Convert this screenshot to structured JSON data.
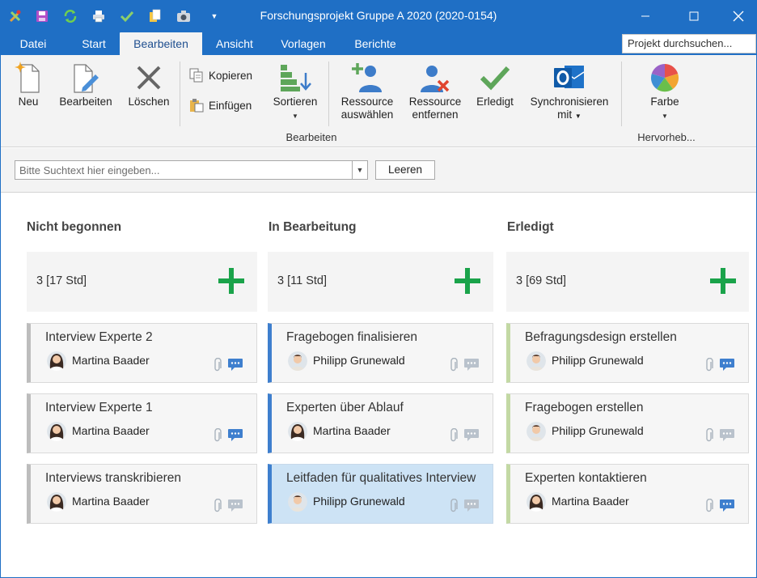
{
  "window": {
    "title": "Forschungsprojekt Gruppe A 2020 (2020-0154)",
    "quick_access": [
      "tools-icon",
      "save-icon",
      "refresh-icon",
      "print-icon",
      "check-icon",
      "copy-icon",
      "camera-icon",
      "customize-dropdown-icon"
    ],
    "controls": {
      "minimize": "—",
      "maximize": "☐",
      "close": "✕"
    }
  },
  "menu": {
    "tabs": [
      {
        "label": "Datei"
      },
      {
        "label": "Start"
      },
      {
        "label": "Bearbeiten"
      },
      {
        "label": "Ansicht"
      },
      {
        "label": "Vorlagen"
      },
      {
        "label": "Berichte"
      }
    ],
    "active_tab": "Bearbeiten",
    "project_search": "Projekt durchsuchen..."
  },
  "ribbon": {
    "neu": "Neu",
    "bearbeiten": "Bearbeiten",
    "loeschen": "Löschen",
    "kopieren": "Kopieren",
    "einfuegen": "Einfügen",
    "sortieren": "Sortieren",
    "ressource_auswaehlen_1": "Ressource",
    "ressource_auswaehlen_2": "auswählen",
    "ressource_entfernen_1": "Ressource",
    "ressource_entfernen_2": "entfernen",
    "erledigt": "Erledigt",
    "sync_1": "Synchronisieren",
    "sync_2": "mit",
    "farbe": "Farbe",
    "group_bearbeiten": "Bearbeiten",
    "group_hervorheben": "Hervorheb..."
  },
  "filter": {
    "placeholder": "Bitte Suchtext hier eingeben...",
    "clear_label": "Leeren"
  },
  "columns": [
    {
      "title": "Nicht begonnen",
      "summary": "3 [17 Std]",
      "cards": [
        {
          "title": "Interview Experte 2",
          "person": "Martina Baader",
          "comment_active": true
        },
        {
          "title": "Interview Experte 1",
          "person": "Martina Baader",
          "comment_active": true
        },
        {
          "title": "Interviews transkribieren",
          "person": "Martina Baader",
          "comment_active": false
        }
      ]
    },
    {
      "title": "In Bearbeitung",
      "summary": "3 [11 Std]",
      "cards": [
        {
          "title": "Fragebogen finalisieren",
          "person": "Philipp Grunewald",
          "comment_active": false
        },
        {
          "title": "Experten über Ablauf",
          "person": "Martina Baader",
          "comment_active": false
        },
        {
          "title": "Leitfaden für qualitatives Interview",
          "person": "Philipp Grunewald",
          "comment_active": false,
          "selected": true
        }
      ]
    },
    {
      "title": "Erledigt",
      "summary": "3 [69 Std]",
      "cards": [
        {
          "title": "Befragungsdesign erstellen",
          "person": "Philipp Grunewald",
          "comment_active": true
        },
        {
          "title": "Fragebogen erstellen",
          "person": "Philipp Grunewald",
          "comment_active": false
        },
        {
          "title": "Experten kontaktieren",
          "person": "Martina Baader",
          "comment_active": true
        }
      ]
    }
  ],
  "colors": {
    "titlebar": "#1f6fc5",
    "plus": "#1aa34a",
    "col_not_started": "#bdbdbd",
    "col_in_progress": "#3e7fce",
    "col_done": "#c3d9a4",
    "selected_card": "#cde3f5",
    "comment_active": "#3e7fce",
    "comment_inactive": "#b9c2cc"
  }
}
